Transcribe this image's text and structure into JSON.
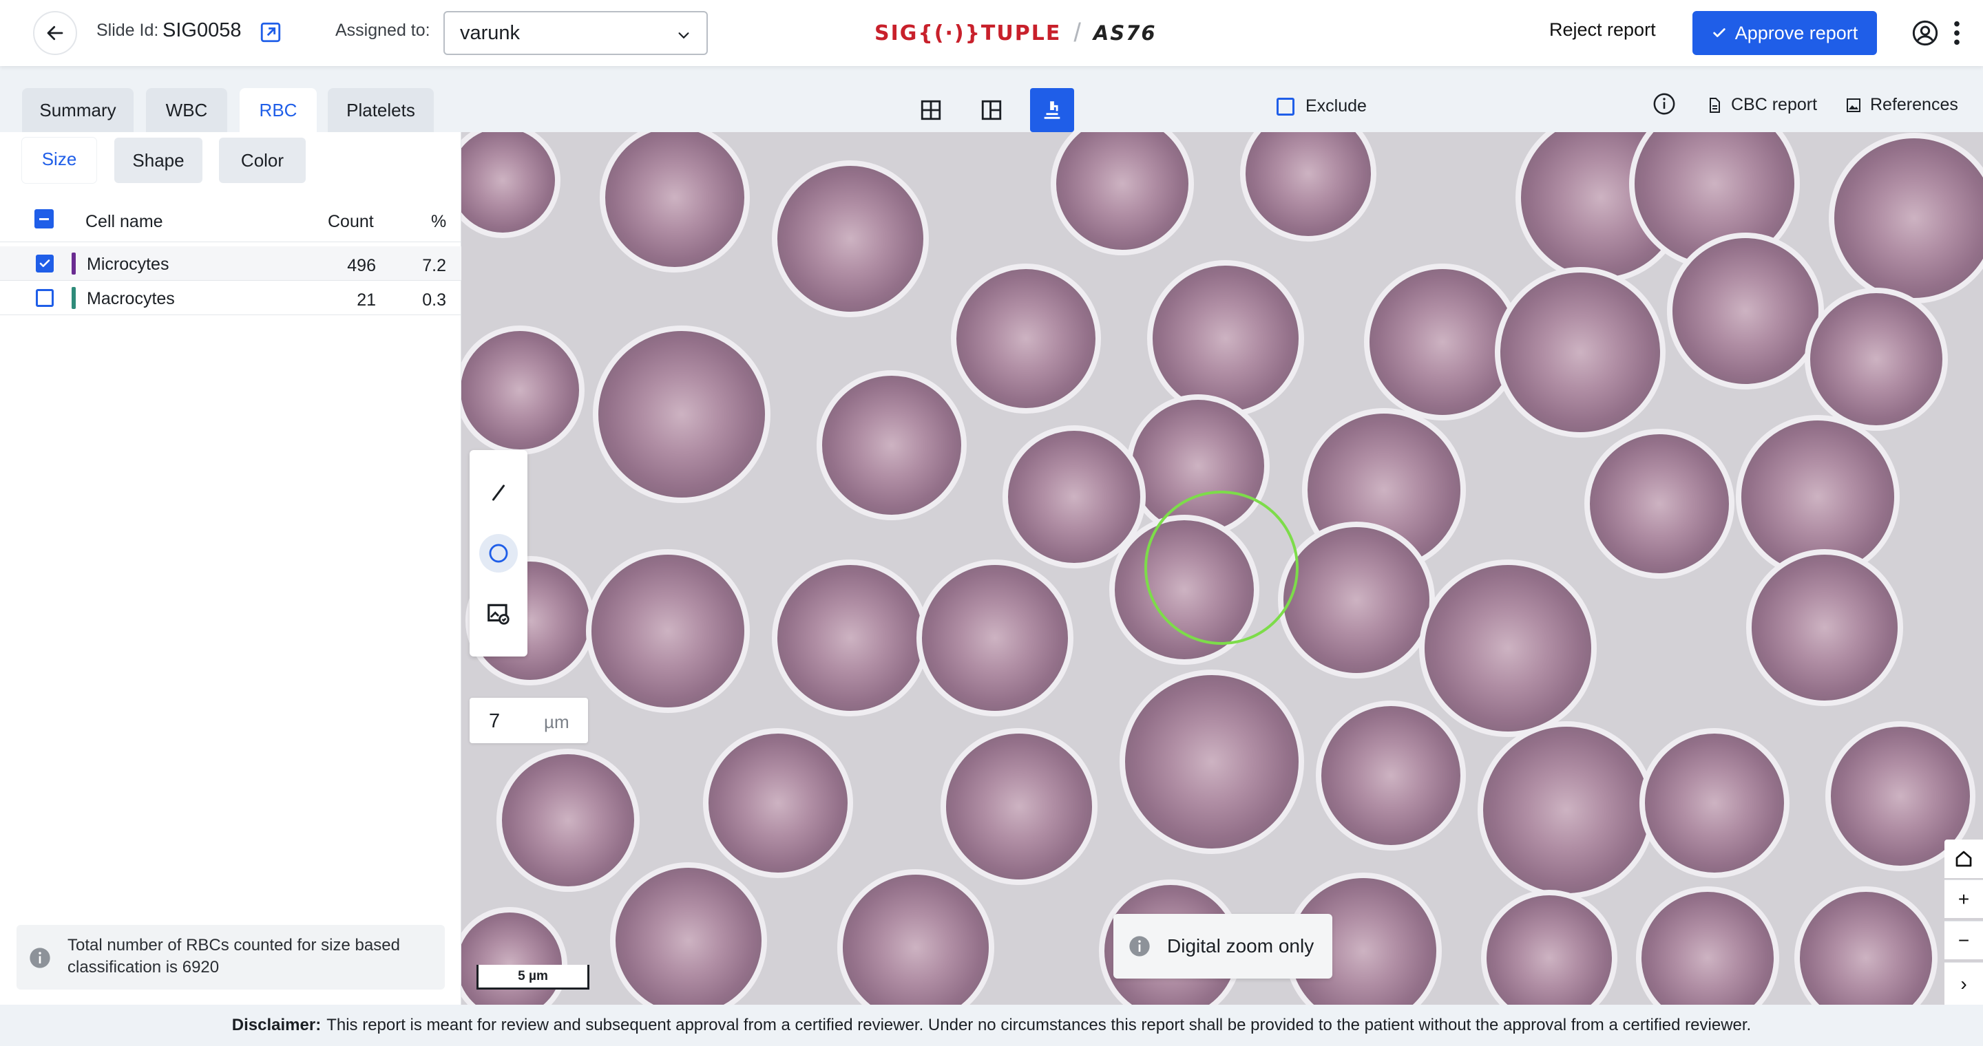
{
  "header": {
    "slide_id_label": "Slide Id:",
    "slide_id": "SIG0058",
    "assigned_label": "Assigned to:",
    "assignee": "varunk",
    "logo_brand": "SIG{(·)}TUPLE",
    "logo_model": "AS76",
    "reject_label": "Reject report",
    "approve_label": "Approve report"
  },
  "tabs": [
    {
      "label": "Summary",
      "active": false
    },
    {
      "label": "WBC",
      "active": false
    },
    {
      "label": "RBC",
      "active": true
    },
    {
      "label": "Platelets",
      "active": false
    }
  ],
  "subtabs": [
    {
      "label": "Size",
      "active": true
    },
    {
      "label": "Shape",
      "active": false
    },
    {
      "label": "Color",
      "active": false
    }
  ],
  "table": {
    "headers": {
      "name": "Cell name",
      "count": "Count",
      "percent": "%"
    },
    "rows": [
      {
        "name": "Microcytes",
        "count": "496",
        "percent": "7.2",
        "checked": true,
        "color": "#6a2c91"
      },
      {
        "name": "Macrocytes",
        "count": "21",
        "percent": "0.3",
        "checked": false,
        "color": "#2e8b7a"
      }
    ]
  },
  "info_text": "Total number of RBCs counted for size based classification is 6920",
  "toolbar": {
    "exclude_label": "Exclude",
    "cbc_report_label": "CBC report",
    "references_label": "References"
  },
  "viewer": {
    "measure_value": "7",
    "measure_unit": "µm",
    "scalebar_label": "5 µm",
    "zoom_notice": "Digital zoom only",
    "zoom_in": "+",
    "zoom_out": "−",
    "expand": "›"
  },
  "footer": {
    "disclaimer_label": "Disclaimer:",
    "disclaimer_text": "This report is meant for review and subsequent approval from a certified reviewer. Under no circumstances this report shall be provided to the patient without the approval from a certified reviewer."
  },
  "colors": {
    "accent": "#1f5ee8",
    "brand_red": "#c8202b",
    "annotation_circle": "#7ddc4a"
  },
  "icons": [
    "arrow-left-icon",
    "open-external-icon",
    "chevron-down-icon",
    "check-icon",
    "user-circle-icon",
    "kebab-icon",
    "grid-4-icon",
    "layout-icon",
    "microscope-icon",
    "info-circle-icon",
    "document-icon",
    "image-icon",
    "line-tool-icon",
    "circle-tool-icon",
    "image-edit-icon",
    "home-icon"
  ]
}
